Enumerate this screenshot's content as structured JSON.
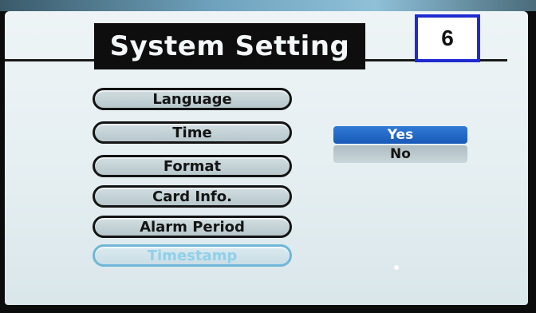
{
  "header": {
    "title": "System Setting",
    "page_number": "6"
  },
  "menu": {
    "items": [
      {
        "label": "Language",
        "state": "normal"
      },
      {
        "label": "Time",
        "state": "normal"
      },
      {
        "label": "Format",
        "state": "normal"
      },
      {
        "label": "Card Info.",
        "state": "normal"
      },
      {
        "label": "Alarm Period",
        "state": "normal"
      },
      {
        "label": "Timestamp",
        "state": "active-highlight"
      }
    ]
  },
  "options": {
    "yes_label": "Yes",
    "no_label": "No",
    "selected": "Yes"
  },
  "colors": {
    "selection": "#1f6acb",
    "badge_border": "#1f2ad0",
    "screen_bg": "#e6eff2"
  }
}
